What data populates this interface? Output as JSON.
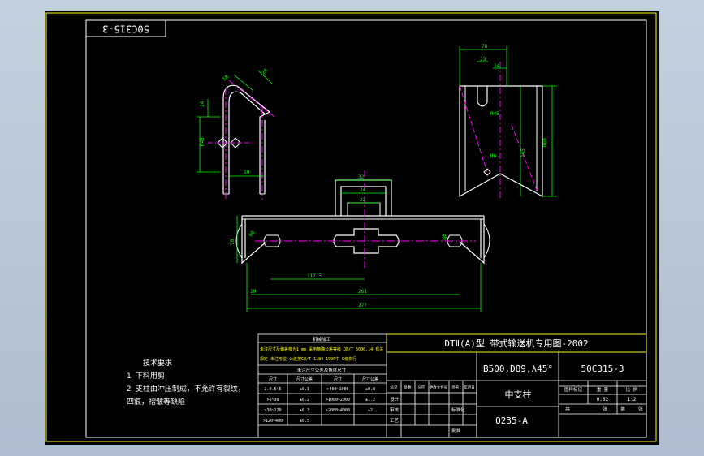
{
  "drawing": {
    "code_stamp": "50C315-3",
    "title_line": "DTⅡ(A)型  带式输送机专用图-2002",
    "spec": "B500,D89,λ45°",
    "drawing_number": "50C315-3",
    "part_name": "中支柱",
    "material": "Q235-A",
    "scale_header": [
      "图样标记",
      "重 量",
      "比 例"
    ],
    "scale_values": [
      "",
      "0.62",
      "1:2"
    ],
    "sheet_labels": [
      "共",
      "张",
      "第",
      "张"
    ]
  },
  "tech_requirements": {
    "heading": "技术要求",
    "lines": [
      "1 下料用剪",
      "2 支柱由冲压制成，不允许有裂纹，",
      "   四痕，褶皱等缺陷"
    ]
  },
  "tolerance_table": {
    "heading": "机械加工",
    "note1": "未注尺寸及偏差按为1 mm 采用精确公差等级 JB/T 5000.14 有关",
    "note2": "规定 未注形位 公差按GB/T 1184-1996中 K级执行",
    "subheading": "未注尺寸公差及角度尺寸",
    "cols": [
      "尺寸",
      "尺寸公差",
      "尺寸",
      "尺寸公差"
    ],
    "rows": [
      [
        "2.0.5~6",
        "±0.1",
        ">400~1000",
        "±0.8"
      ],
      [
        ">6~30",
        "±0.2",
        ">1000~2000",
        "±1.2"
      ],
      [
        ">30~120",
        "±0.3",
        ">2000~4000",
        "±2"
      ],
      [
        ">120~400",
        "±0.5",
        "",
        ""
      ]
    ]
  },
  "revision_block": {
    "header": [
      "标记",
      "处数",
      "分区",
      "更改文件号",
      "签名",
      "年月日"
    ],
    "rows": [
      "设计",
      "审核",
      "工艺",
      "",
      "",
      "",
      "",
      "",
      "",
      ""
    ],
    "approval_labels": [
      "标准化",
      "批准"
    ]
  },
  "dimensions": {
    "left_view": [
      "18",
      "20",
      "24",
      "R45",
      "10"
    ],
    "right_view": [
      "78",
      "23",
      "14",
      "R6",
      "145",
      "R80",
      "R45"
    ],
    "bottom_view": [
      "32",
      "24",
      "22",
      "70",
      "117.5",
      "10",
      "261",
      "277",
      "R6",
      "R6"
    ]
  },
  "colors": {
    "frame": "#ffff00",
    "geometry": "#ffffff",
    "dimension": "#00ff00",
    "centerline": "#ff00ff",
    "text": "#ffffff"
  }
}
